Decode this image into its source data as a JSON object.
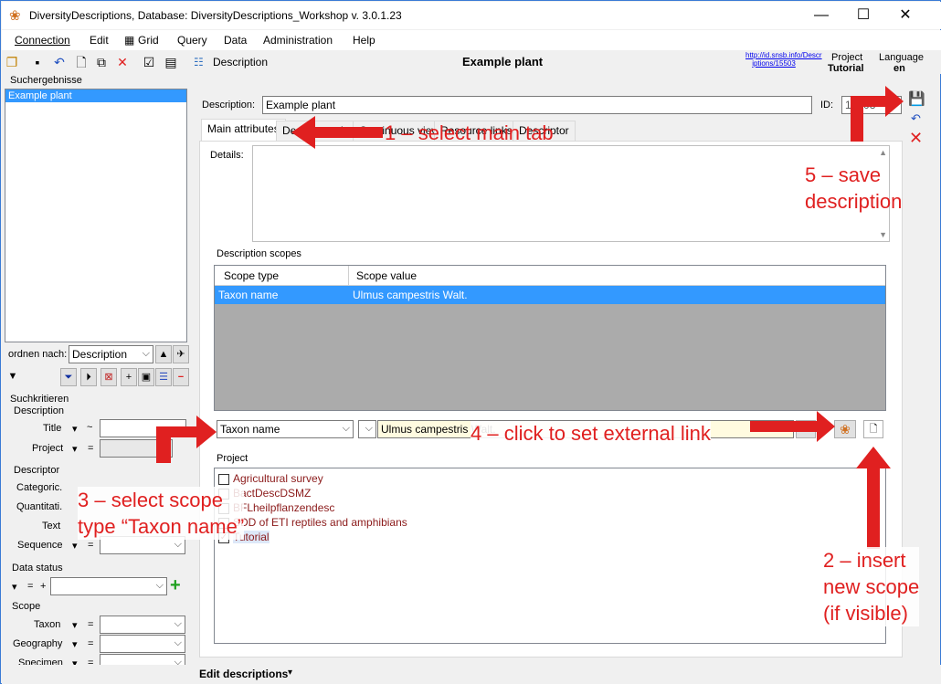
{
  "window": {
    "title": "DiversityDescriptions,  Database: DiversityDescriptions_Workshop   v. 3.0.1.23",
    "minimize": "—",
    "maximize": "☐",
    "close": "✕"
  },
  "menu": [
    "Connection",
    "Edit",
    "Grid",
    "Query",
    "Data",
    "Administration",
    "Help"
  ],
  "toolbar": {
    "description_label": "Description",
    "heading": "Example plant",
    "link_line1": "http://id.snsb.info/Descr",
    "link_line2": "iptions/15503",
    "project_label": "Project",
    "project_value": "Tutorial",
    "language_label": "Language",
    "language_value": "en"
  },
  "left": {
    "results_header": "Suchergebnisse",
    "results": [
      "Example plant"
    ],
    "order_label": "ordnen nach:",
    "order_value": "Description",
    "criteria_header": "Suchkritieren",
    "description_group": "Description",
    "title_label": "Title",
    "title_op": "~",
    "project_label": "Project",
    "project_op": "=",
    "descriptor_group": "Descriptor",
    "categoric_label": "Categoric.",
    "quantitative_label": "Quantitati.",
    "text_label": "Text",
    "sequence_label": "Sequence",
    "sequence_op": "=",
    "data_status_group": "Data status",
    "data_status_op1": "=",
    "data_status_op2": "+",
    "scope_group": "Scope",
    "taxon_label": "Taxon",
    "geography_label": "Geography",
    "specimen_label": "Specimen",
    "eq": "="
  },
  "main": {
    "description_label": "Description:",
    "description_value": "Example plant",
    "id_label": "ID:",
    "id_value": "15503",
    "tabs": [
      "Main attributes",
      "Descriptor view",
      "Continuous view",
      "Resource links",
      "Descriptor"
    ],
    "details_label": "Details:",
    "scopes_label": "Description scopes",
    "grid_headers": [
      "Scope type",
      "Scope value"
    ],
    "grid_rows": [
      [
        "Taxon name",
        "Ulmus campestris Walt."
      ]
    ],
    "scope_type_value": "Taxon name",
    "scope_value_value": "Ulmus campestris Walt.",
    "project_section": "Project",
    "projects": [
      {
        "label": "Agricultural survey",
        "checked": false
      },
      {
        "label": "BactDescDSMZ",
        "checked": false
      },
      {
        "label": "BFLheilpflanzendesc",
        "checked": false
      },
      {
        "label": "SDD of ETI reptiles and amphibians",
        "checked": false
      },
      {
        "label": "Tutorial",
        "checked": true
      }
    ]
  },
  "callouts": {
    "c1": "1 – select main tab",
    "c2_line1": "2 – insert",
    "c2_line2": "new scope",
    "c2_line3": "(if visible)",
    "c3_line1": "3 – select scope",
    "c3_line2": "type “Taxon  name”",
    "c4": "4 – click to set external link",
    "c5_line1": "5 – save",
    "c5_line2": "description"
  },
  "status": {
    "edit_descriptions": "Edit descriptions"
  },
  "colors": {
    "accent": "#e02020",
    "selection": "#3399ff",
    "link": "#0000ee",
    "project_text": "#8b1a1a"
  }
}
